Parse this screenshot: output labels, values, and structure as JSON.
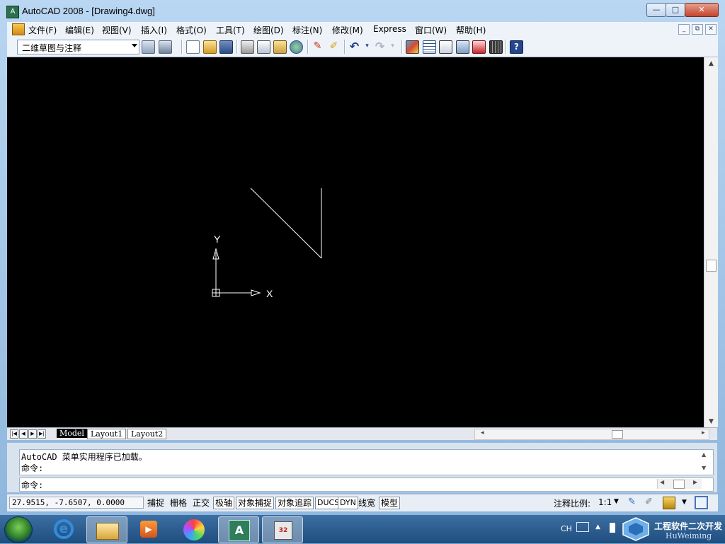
{
  "window": {
    "title": "AutoCAD 2008 - [Drawing4.dwg]",
    "controls": {
      "minimize": "—",
      "maximize": "□",
      "close": "✕"
    }
  },
  "menu": {
    "items": [
      "文件(F)",
      "编辑(E)",
      "视图(V)",
      "插入(I)",
      "格式(O)",
      "工具(T)",
      "绘图(D)",
      "标注(N)",
      "修改(M)",
      "Express",
      "窗口(W)",
      "帮助(H)"
    ],
    "mdi_controls": [
      "_",
      "⧉",
      "✕"
    ]
  },
  "toolbar": {
    "workspace": "二维草图与注释",
    "icons": [
      "workspace-settings-icon",
      "my-workspace-icon",
      "new-icon",
      "open-icon",
      "save-icon",
      "plot-icon",
      "plot-preview-icon",
      "publish-icon",
      "3d-dwf-icon",
      "cut-icon",
      "match-properties-icon",
      "undo-icon",
      "redo-icon",
      "properties-icon",
      "design-center-icon",
      "tool-palettes-icon",
      "sheet-set-icon",
      "markup-icon",
      "calculator-icon",
      "help-icon"
    ]
  },
  "drawing": {
    "ucs": {
      "x_label": "X",
      "y_label": "Y"
    },
    "lines": 2,
    "background": "#000000",
    "stroke": "#ffffff"
  },
  "layout_tabs": [
    "Model",
    "Layout1",
    "Layout2"
  ],
  "command": {
    "history": [
      "AutoCAD 菜单实用程序已加载。",
      "命令:"
    ],
    "prompt": "命令:"
  },
  "status": {
    "coordinates": "27.9515, -7.6507, 0.0000",
    "toggles": [
      {
        "label": "捕捉",
        "on": false
      },
      {
        "label": "栅格",
        "on": false
      },
      {
        "label": "正交",
        "on": false
      },
      {
        "label": "极轴",
        "on": true
      },
      {
        "label": "对象捕捉",
        "on": true
      },
      {
        "label": "对象追踪",
        "on": true
      },
      {
        "label": "DUCS",
        "on": true
      },
      {
        "label": "DYN",
        "on": true
      },
      {
        "label": "线宽",
        "on": false
      },
      {
        "label": "模型",
        "on": true
      }
    ],
    "annotation_scale_label": "注释比例:",
    "annotation_scale": "1:1"
  },
  "taskbar": {
    "apps": [
      "file-explorer-icon",
      "internet-explorer-icon",
      "media-player-icon",
      "color-wheel-icon",
      "autocad-icon",
      "installer-32-icon"
    ],
    "tray_language": "CH",
    "watermark_title": "工程软件二次开发",
    "watermark_sub": "HuWeiming"
  }
}
